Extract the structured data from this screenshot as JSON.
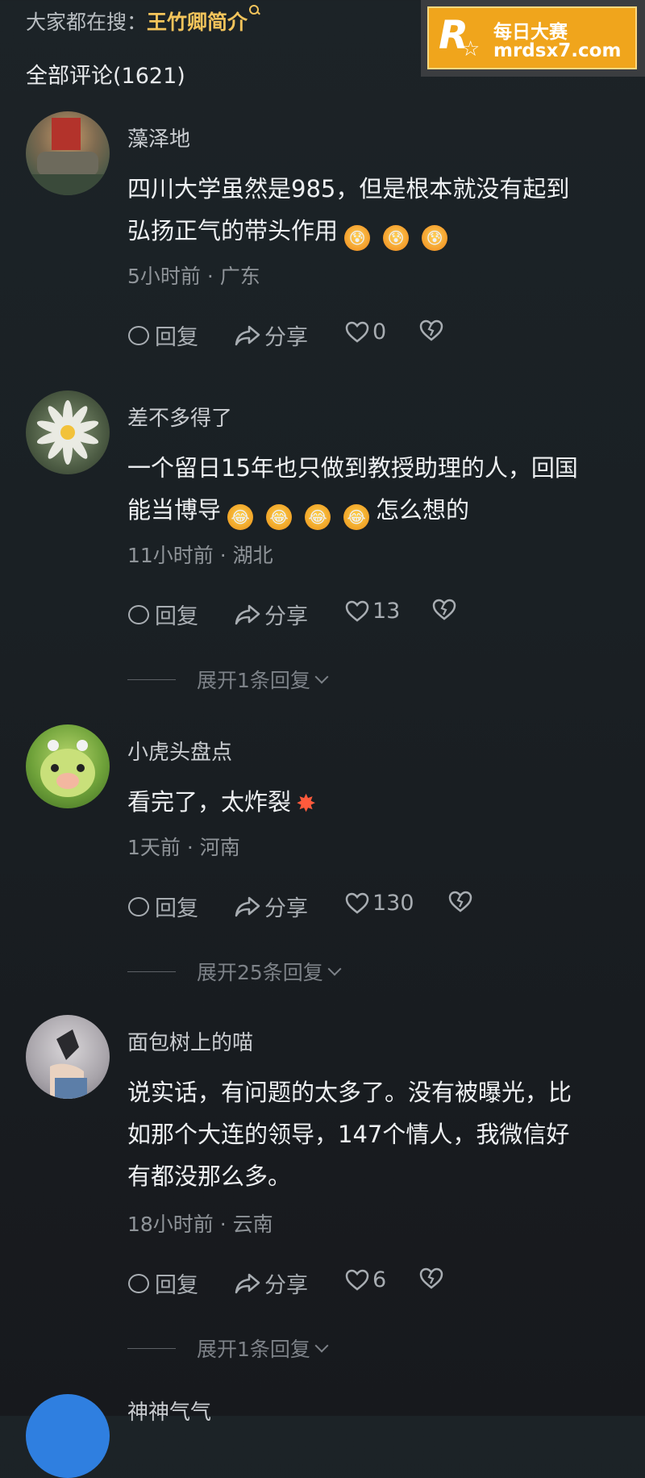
{
  "search_bar": {
    "prefix": "大家都在搜：",
    "keyword": "王竹卿简介"
  },
  "watermark": {
    "logo_letter": "R",
    "line1": "每日大赛",
    "line2": "mrdsx7.com"
  },
  "comment_count_label": "全部评论(1621)",
  "action_labels": {
    "reply": "回复",
    "share": "分享"
  },
  "comments": [
    {
      "username": "藻泽地",
      "lines": [
        "四川大学虽然是985，但是根本就没有起到",
        "弘扬正气的带头作用"
      ],
      "emoji": "sweat-emoji x3",
      "time": "5小时前",
      "location": "广东",
      "likes": "0"
    },
    {
      "username": "差不多得了",
      "lines": [
        "一个留日15年也只做到教授助理的人，回国",
        "能当博导"
      ],
      "line2_suffix": "怎么想的",
      "emoji": "laughing-emoji x4",
      "time": "11小时前",
      "location": "湖北",
      "likes": "13",
      "expand_label": "展开1条回复"
    },
    {
      "username": "小虎头盘点",
      "lines": [
        "看完了，太炸裂"
      ],
      "emoji": "explosion-emoji",
      "time": "1天前",
      "location": "河南",
      "likes": "130",
      "expand_label": "展开25条回复"
    },
    {
      "username": "面包树上的喵",
      "lines": [
        "说实话，有问题的太多了。没有被曝光，比",
        "如那个大连的领导，147个情人，我微信好",
        "有都没那么多。"
      ],
      "time": "18小时前",
      "location": "云南",
      "likes": "6",
      "expand_label": "展开1条回复"
    },
    {
      "username": "神神气气"
    }
  ]
}
